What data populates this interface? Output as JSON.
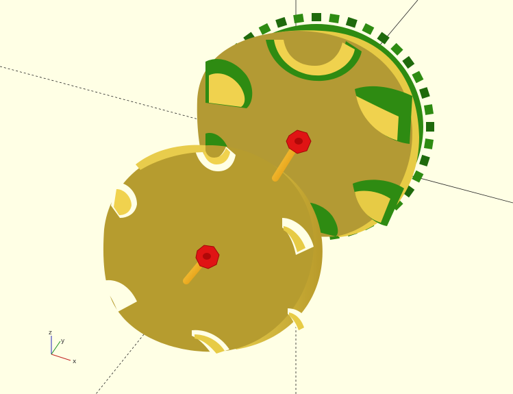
{
  "viewport": {
    "background": "#FFFFE5",
    "part_face_color": "#C9A73A",
    "part_side_color": "#E7CB45",
    "gear_color": "#2E8B12",
    "gear_dark_color": "#1F6A0C",
    "pin_color": "#F2A20A",
    "nut_color": "#E01414"
  },
  "axes_indicator": {
    "icon": "xyz-axes-icon",
    "labels": {
      "x": "x",
      "y": "y",
      "z": "z"
    }
  }
}
